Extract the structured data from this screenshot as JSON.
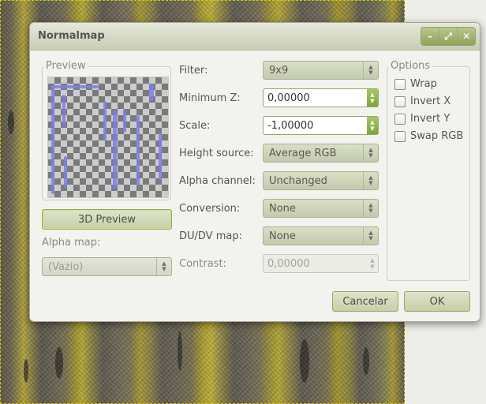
{
  "dialog": {
    "title": "Normalmap",
    "window_buttons": [
      {
        "name": "minimize",
        "glyph": "–"
      },
      {
        "name": "maximize",
        "glyph": "⤢"
      },
      {
        "name": "close",
        "glyph": "✕"
      }
    ]
  },
  "preview": {
    "group_label": "Preview",
    "button_label": "3D Preview"
  },
  "alpha_map": {
    "label": "Alpha map:",
    "value": "(Vazio)"
  },
  "fields": {
    "filter": {
      "label": "Filter:",
      "value": "9x9"
    },
    "minimum_z": {
      "label": "Minimum Z:",
      "value": "0,00000"
    },
    "scale": {
      "label": "Scale:",
      "value": "-1,00000"
    },
    "height_source": {
      "label": "Height source:",
      "value": "Average RGB"
    },
    "alpha_channel": {
      "label": "Alpha channel:",
      "value": "Unchanged"
    },
    "conversion": {
      "label": "Conversion:",
      "value": "None"
    },
    "dudv_map": {
      "label": "DU/DV map:",
      "value": "None"
    },
    "contrast": {
      "label": "Contrast:",
      "value": "0,00000"
    }
  },
  "options": {
    "group_label": "Options",
    "items": [
      {
        "label": "Wrap",
        "checked": false
      },
      {
        "label": "Invert X",
        "checked": false
      },
      {
        "label": "Invert Y",
        "checked": false
      },
      {
        "label": "Swap RGB",
        "checked": false
      }
    ]
  },
  "buttons": {
    "cancel": "Cancelar",
    "ok": "OK"
  },
  "colors": {
    "accent": "#8fa25a",
    "canvas_border": "#d8c800",
    "preview_stroke": "#7b7ee6"
  }
}
